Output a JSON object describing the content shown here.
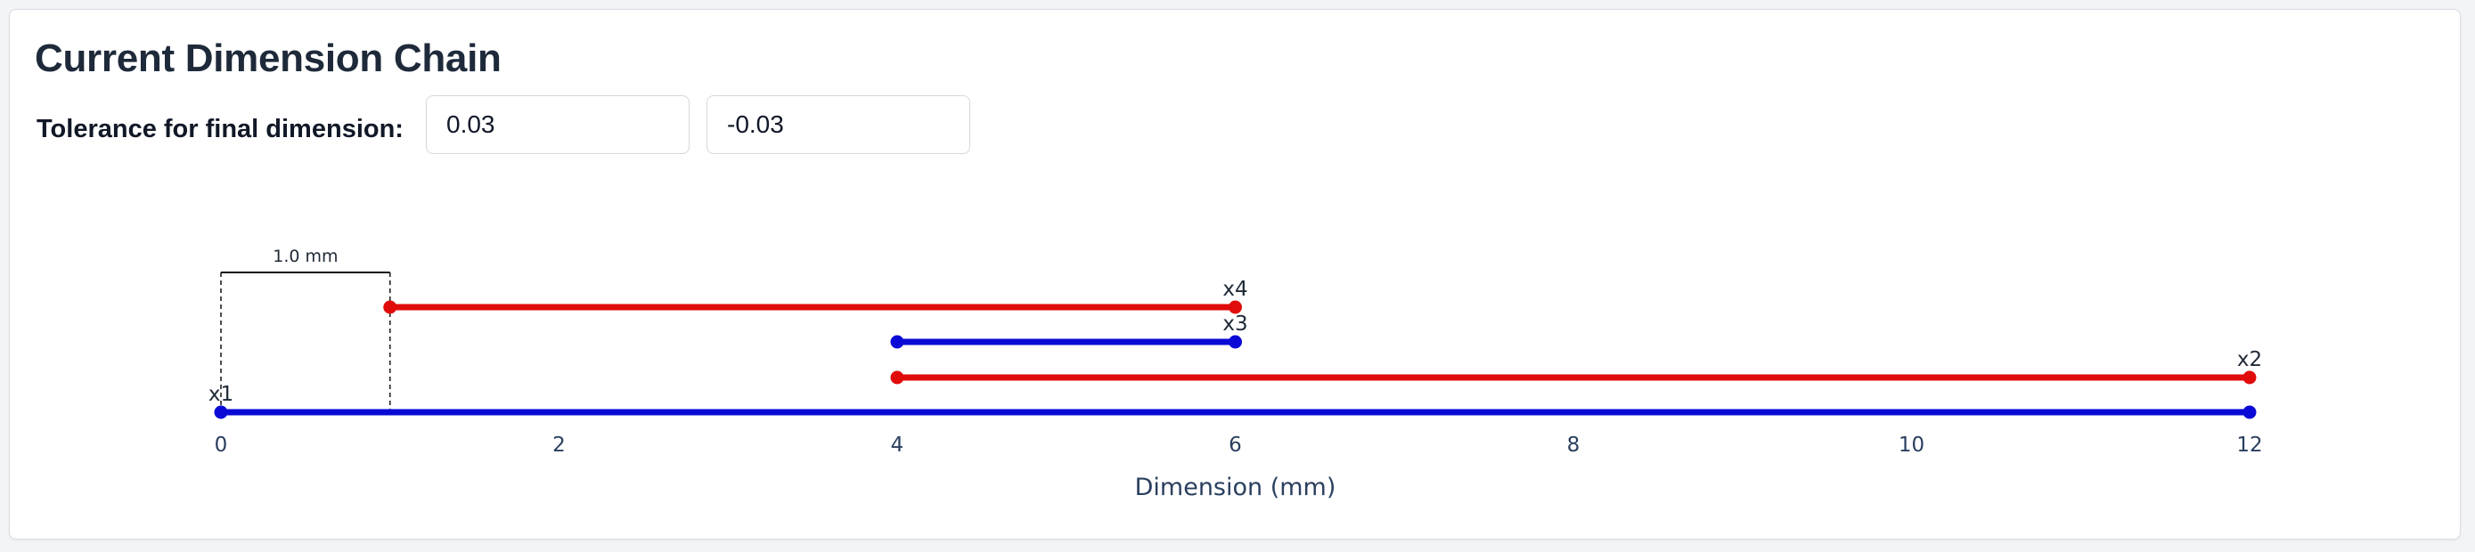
{
  "title": "Current Dimension Chain",
  "tolerance": {
    "label": "Tolerance for final dimension:",
    "upper": "0.03",
    "lower": "-0.03"
  },
  "chart_data": {
    "type": "line",
    "xlabel": "Dimension (mm)",
    "xlim": [
      0,
      12
    ],
    "xticks": [
      0,
      2,
      4,
      6,
      8,
      10,
      12
    ],
    "grid": false,
    "colors": {
      "blue": "#0a0ad6",
      "red": "#e00b0b"
    },
    "segments": [
      {
        "name": "x1",
        "x_start": 0,
        "x_end": 12,
        "color": "blue"
      },
      {
        "name": "x2",
        "x_start": 4,
        "x_end": 12,
        "color": "red"
      },
      {
        "name": "x3",
        "x_start": 4,
        "x_end": 6,
        "color": "blue"
      },
      {
        "name": "x4",
        "x_start": 1,
        "x_end": 6,
        "color": "red"
      }
    ],
    "scale_indicator": {
      "label": "1.0 mm",
      "x_start": 0,
      "x_end": 1
    }
  }
}
